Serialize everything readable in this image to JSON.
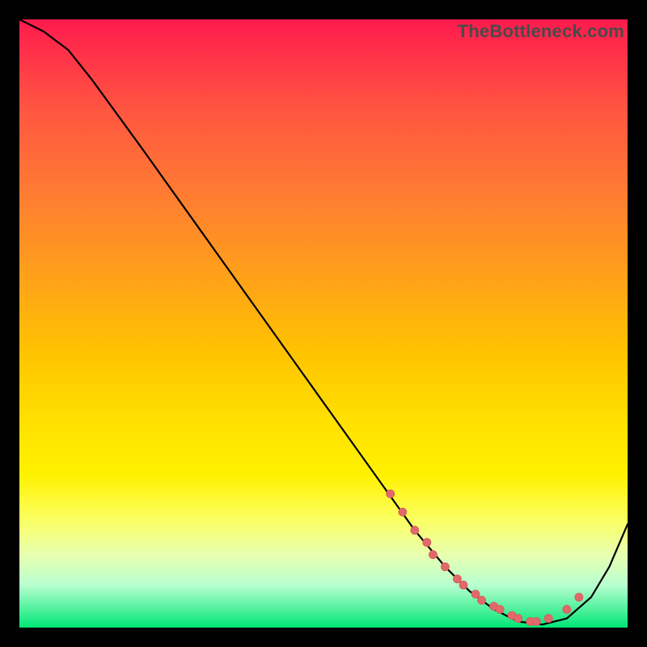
{
  "watermark": "TheBottleneck.com",
  "chart_data": {
    "type": "line",
    "title": "",
    "xlabel": "",
    "ylabel": "",
    "xlim": [
      0,
      100
    ],
    "ylim": [
      0,
      100
    ],
    "grid": false,
    "series": [
      {
        "name": "curve",
        "x": [
          0,
          4,
          8,
          12,
          20,
          30,
          40,
          50,
          60,
          65,
          70,
          74,
          78,
          82,
          86,
          90,
          94,
          97,
          100
        ],
        "y": [
          100,
          98,
          95,
          90,
          79,
          65,
          51,
          37,
          23,
          16,
          10,
          6,
          3,
          1,
          0.5,
          1.5,
          5,
          10,
          17
        ]
      }
    ],
    "markers": {
      "name": "dots",
      "x": [
        61,
        63,
        65,
        67,
        68,
        70,
        72,
        73,
        75,
        76,
        78,
        79,
        81,
        82,
        84,
        85,
        87,
        90,
        92
      ],
      "y": [
        22,
        19,
        16,
        14,
        12,
        10,
        8,
        7,
        5.5,
        4.5,
        3.5,
        3,
        2,
        1.5,
        1,
        1,
        1.5,
        3,
        5
      ]
    },
    "gradient_stops": [
      {
        "pos": 0.0,
        "color": "#ff1a4d"
      },
      {
        "pos": 0.15,
        "color": "#ff5640"
      },
      {
        "pos": 0.42,
        "color": "#ffa01a"
      },
      {
        "pos": 0.66,
        "color": "#ffe000"
      },
      {
        "pos": 0.88,
        "color": "#e8ffb0"
      },
      {
        "pos": 1.0,
        "color": "#00e676"
      }
    ]
  }
}
